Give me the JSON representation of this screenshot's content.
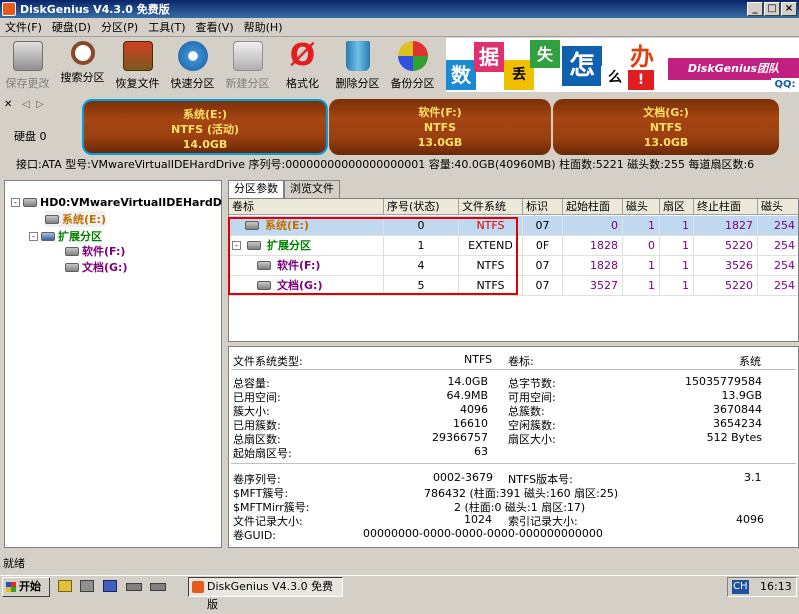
{
  "window": {
    "title": "DiskGenius V4.3.0 免费版"
  },
  "menu": [
    "文件(F)",
    "硬盘(D)",
    "分区(P)",
    "工具(T)",
    "查看(V)",
    "帮助(H)"
  ],
  "toolbar": [
    "保存更改",
    "搜索分区",
    "恢复文件",
    "快速分区",
    "新建分区",
    "格式化",
    "删除分区",
    "备份分区"
  ],
  "banner": {
    "chars": [
      "数",
      "据",
      "丢",
      "失",
      "怎",
      "么",
      "办",
      "!"
    ],
    "brand": "DiskGenius团队",
    "qq": "QQ:"
  },
  "disk": {
    "label": "硬盘 0"
  },
  "partitions": [
    {
      "name": "系统(E:)",
      "fs": "NTFS (活动)",
      "size": "14.0GB"
    },
    {
      "name": "软件(F:)",
      "fs": "NTFS",
      "size": "13.0GB"
    },
    {
      "name": "文档(G:)",
      "fs": "NTFS",
      "size": "13.0GB"
    }
  ],
  "infobar": "接口:ATA  型号:VMwareVirtualIDEHardDrive  序列号:00000000000000000001  容量:40.0GB(40960MB)  柱面数:5221  磁头数:255  每道扇区数:6",
  "tree": {
    "root": "HD0:VMwareVirtualIDEHardD",
    "items": [
      "系统(E:)",
      "扩展分区",
      "软件(F:)",
      "文档(G:)"
    ]
  },
  "tabs": [
    "分区参数",
    "浏览文件"
  ],
  "grid": {
    "headers": [
      "卷标",
      "序号(状态)",
      "文件系统",
      "标识",
      "起始柱面",
      "磁头",
      "扇区",
      "终止柱面",
      "磁头"
    ],
    "rows": [
      [
        "系统(E:)",
        "0",
        "NTFS",
        "07",
        "0",
        "1",
        "1",
        "1827",
        "254"
      ],
      [
        "扩展分区",
        "1",
        "EXTEND",
        "0F",
        "1828",
        "0",
        "1",
        "5220",
        "254"
      ],
      [
        "软件(F:)",
        "4",
        "NTFS",
        "07",
        "1828",
        "1",
        "1",
        "3526",
        "254"
      ],
      [
        "文档(G:)",
        "5",
        "NTFS",
        "07",
        "3527",
        "1",
        "1",
        "5220",
        "254"
      ]
    ]
  },
  "details": {
    "fs_label": "文件系统类型:",
    "fs": "NTFS",
    "vol_label": "卷标:",
    "vol": "系统",
    "left": [
      [
        "总容量:",
        "14.0GB"
      ],
      [
        "已用空间:",
        "64.9MB"
      ],
      [
        "簇大小:",
        "4096"
      ],
      [
        "已用簇数:",
        "16610"
      ],
      [
        "总扇区数:",
        "29366757"
      ],
      [
        "起始扇区号:",
        "63"
      ]
    ],
    "right": [
      [
        "总字节数:",
        "15035779584"
      ],
      [
        "可用空间:",
        "13.9GB"
      ],
      [
        "总簇数:",
        "3670844"
      ],
      [
        "空闲簇数:",
        "3654234"
      ],
      [
        "扇区大小:",
        "512 Bytes"
      ]
    ],
    "serial_label": "卷序列号:",
    "serial": "0002-3679",
    "ntfsver_label": "NTFS版本号:",
    "ntfsver": "3.1",
    "mft_label": "$MFT簇号:",
    "mft": "786432 (柱面:391 磁头:160 扇区:25)",
    "mftmirr_label": "$MFTMirr簇号:",
    "mftmirr": "2 (柱面:0 磁头:1 扇区:17)",
    "frs_label": "文件记录大小:",
    "frs": "1024",
    "irs_label": "索引记录大小:",
    "irs": "4096",
    "guid_label": "卷GUID:",
    "guid": "00000000-0000-0000-0000-000000000000"
  },
  "status": "就绪",
  "taskbar": {
    "start": "开始",
    "app": "DiskGenius V4.3.0 免费版",
    "ime": "CH",
    "time": "16:13"
  },
  "colors": {
    "partition": "#9a4010",
    "partition_text": "#ffe066",
    "highlight": "#e00000",
    "num_purple": "#800080"
  }
}
